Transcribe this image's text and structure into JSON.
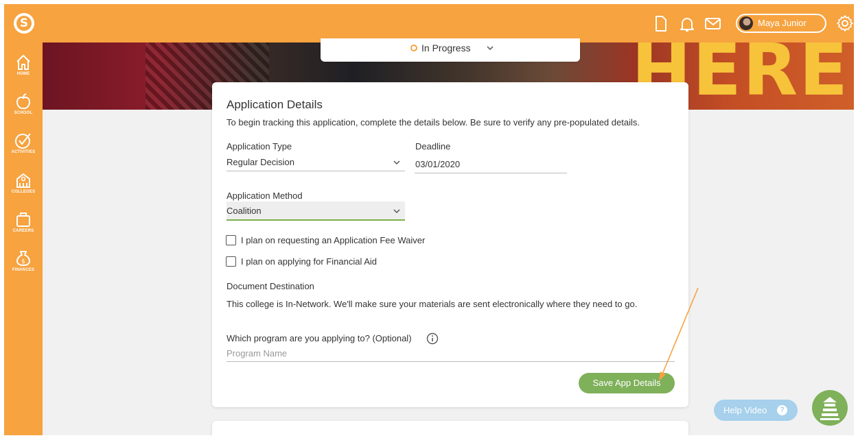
{
  "app": {
    "logo_letter": "S"
  },
  "topbar": {
    "user_name": "Maya Junior"
  },
  "sidebar": {
    "items": [
      {
        "label": "HOME",
        "icon": "home-icon"
      },
      {
        "label": "SCHOOL",
        "icon": "apple-icon"
      },
      {
        "label": "ACTIVITIES",
        "icon": "check-circle-icon"
      },
      {
        "label": "COLLEGES",
        "icon": "college-icon"
      },
      {
        "label": "CAREERS",
        "icon": "briefcase-icon"
      },
      {
        "label": "FINANCES",
        "icon": "money-bag-icon"
      }
    ]
  },
  "hero": {
    "text": "HERE"
  },
  "status": {
    "label": "In Progress"
  },
  "card": {
    "title": "Application Details",
    "intro": "To begin tracking this application, complete the details below. Be sure to verify any pre-populated details.",
    "application_type": {
      "label": "Application Type",
      "value": "Regular Decision"
    },
    "deadline": {
      "label": "Deadline",
      "value": "03/01/2020"
    },
    "application_method": {
      "label": "Application Method",
      "value": "Coalition"
    },
    "fee_waiver_label": "I plan on requesting an Application Fee Waiver",
    "financial_aid_label": "I plan on applying for Financial Aid",
    "document_destination": {
      "label": "Document Destination",
      "text": "This college is In-Network. We'll make sure your materials are sent electronically where they need to go."
    },
    "program": {
      "label": "Which program are you applying to? (Optional)",
      "placeholder": "Program Name"
    },
    "save_label": "Save App Details"
  },
  "help": {
    "label": "Help Video",
    "q": "?"
  },
  "colors": {
    "brand": "#f6a340",
    "accent_green": "#7fb05a",
    "help_blue": "#a6d0eb",
    "hero_yellow": "#f6c33a"
  }
}
